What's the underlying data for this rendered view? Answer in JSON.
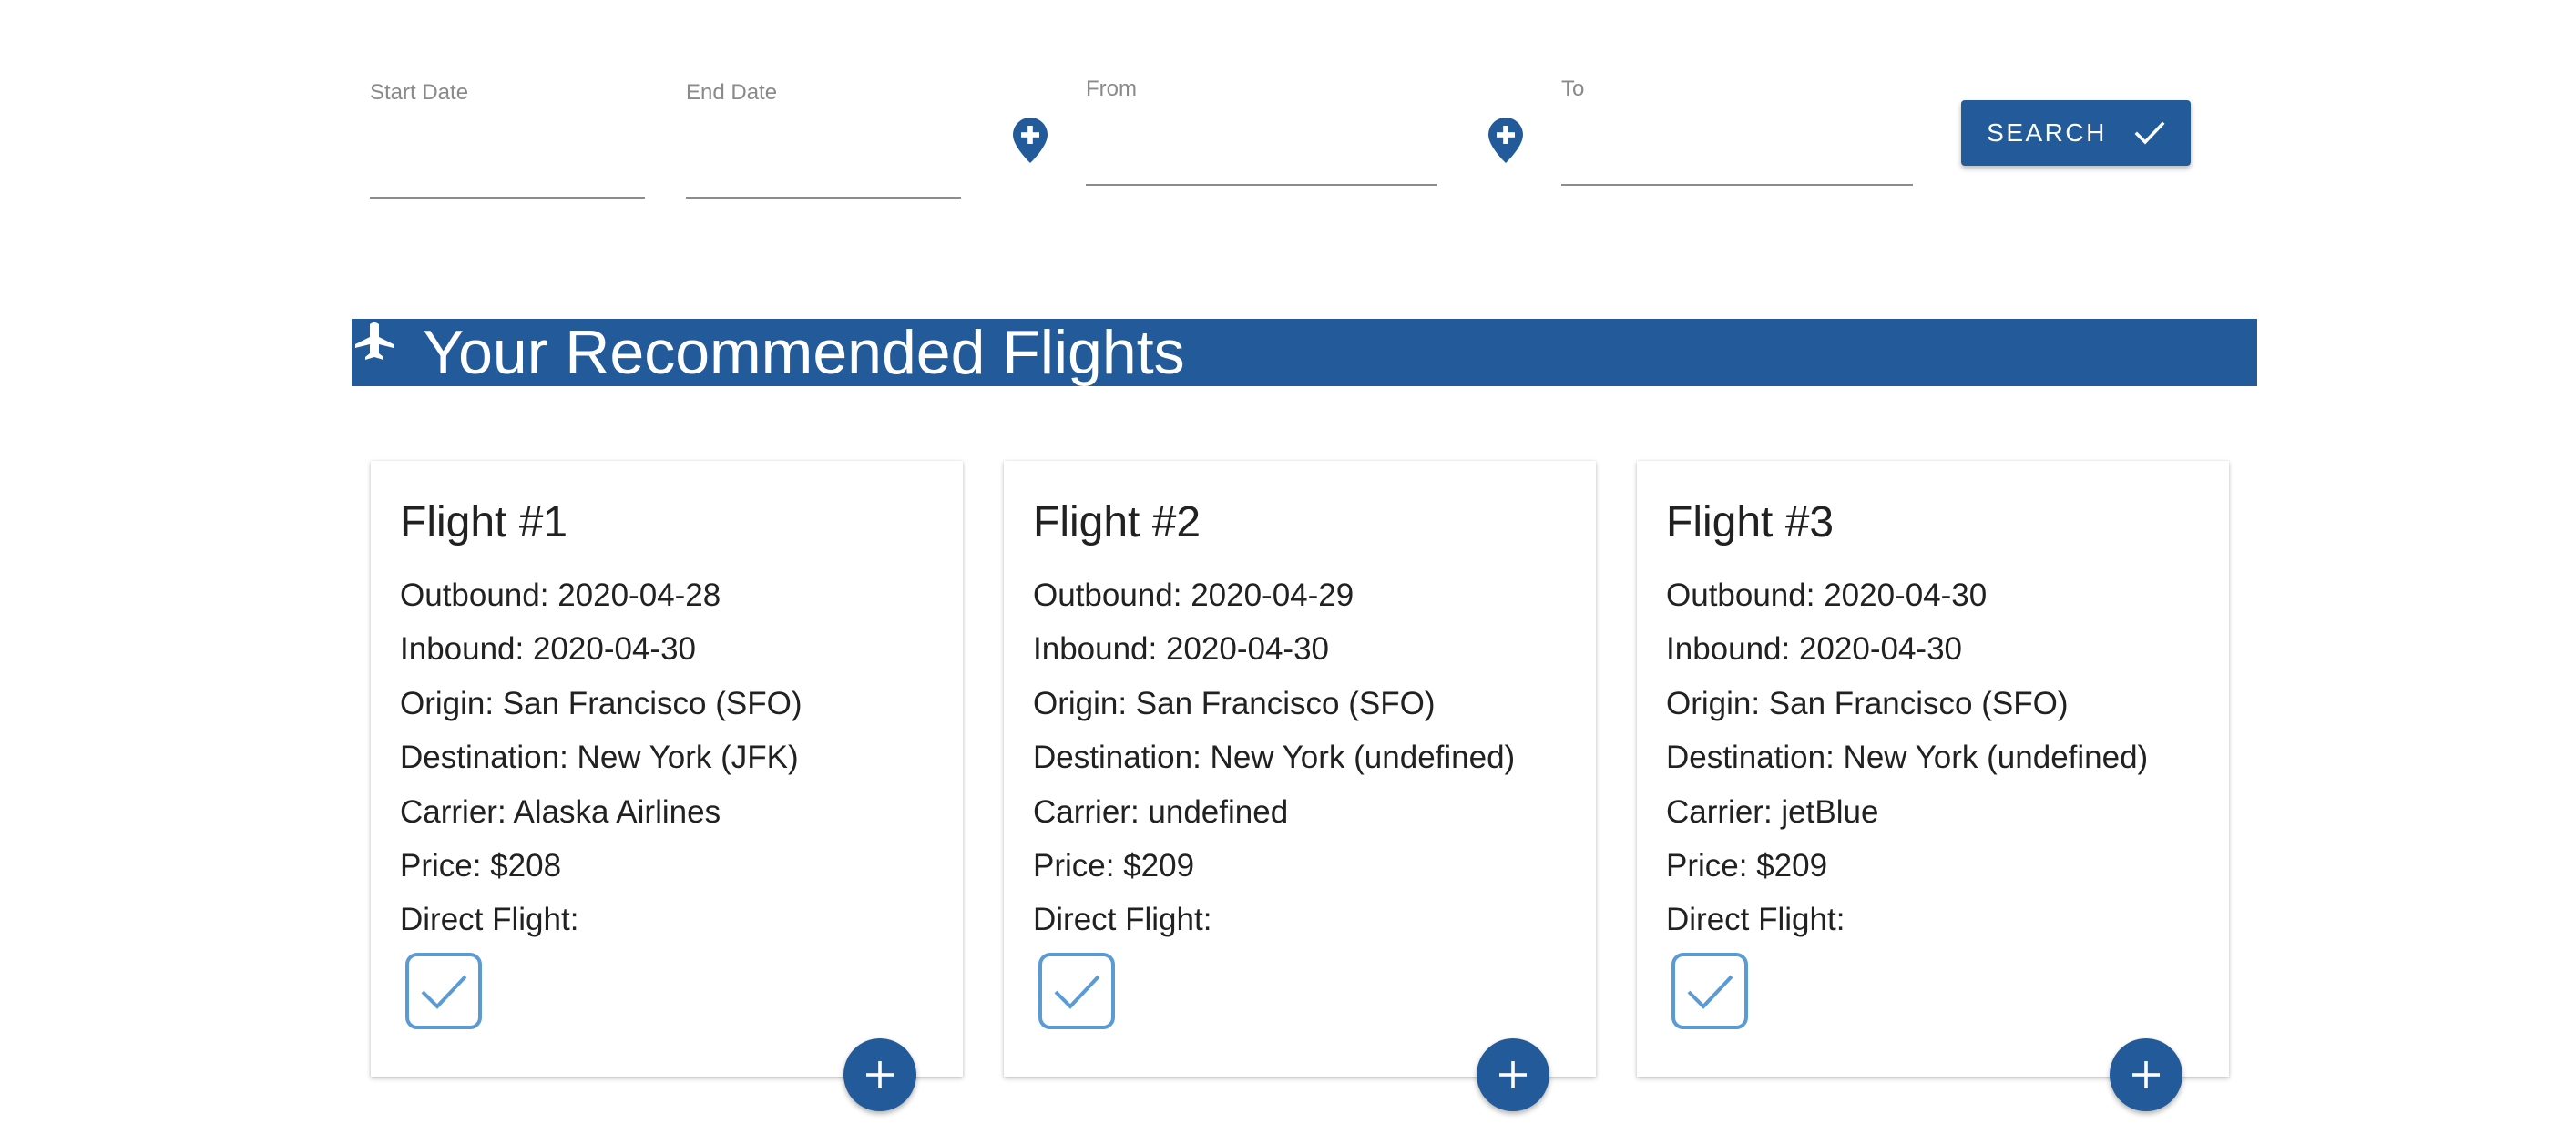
{
  "search": {
    "start_date_label": "Start Date",
    "end_date_label": "End Date",
    "from_label": "From",
    "to_label": "To",
    "start_date_value": "",
    "end_date_value": "",
    "from_value": "",
    "to_value": "",
    "button_label": "SEARCH",
    "button_icon": "check-icon",
    "location_icon": "add-location-icon"
  },
  "banner": {
    "icon": "airplane-icon",
    "title": "Your Recommended Flights"
  },
  "colors": {
    "primary": "#235b9a",
    "checkbox": "#5b9bd5",
    "text": "#212121",
    "label": "#8a8a8a"
  },
  "flights": [
    {
      "title": "Flight #1",
      "outbound": "Outbound: 2020-04-28",
      "inbound": "Inbound: 2020-04-30",
      "origin": "Origin: San Francisco (SFO)",
      "destination": "Destination: New York (JFK)",
      "carrier": "Carrier: Alaska Airlines",
      "price": "Price: $208",
      "direct_label": "Direct Flight:",
      "direct": true
    },
    {
      "title": "Flight #2",
      "outbound": "Outbound: 2020-04-29",
      "inbound": "Inbound: 2020-04-30",
      "origin": "Origin: San Francisco (SFO)",
      "destination": "Destination: New York (undefined)",
      "carrier": "Carrier: undefined",
      "price": "Price: $209",
      "direct_label": "Direct Flight:",
      "direct": true
    },
    {
      "title": "Flight #3",
      "outbound": "Outbound: 2020-04-30",
      "inbound": "Inbound: 2020-04-30",
      "origin": "Origin: San Francisco (SFO)",
      "destination": "Destination: New York (undefined)",
      "carrier": "Carrier: jetBlue",
      "price": "Price: $209",
      "direct_label": "Direct Flight:",
      "direct": true
    }
  ]
}
